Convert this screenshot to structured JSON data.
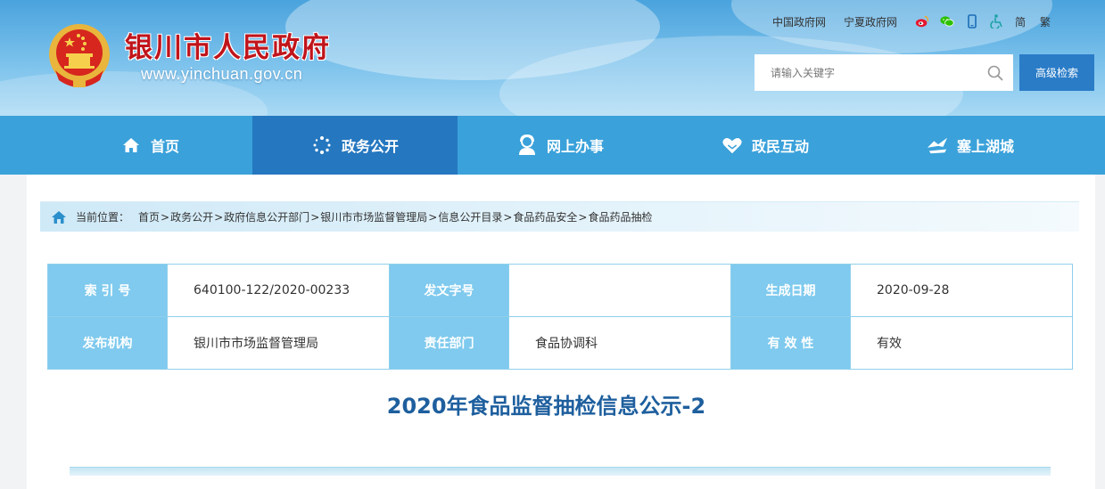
{
  "header": {
    "site_title": "银川市人民政府",
    "site_url": "www.yinchuan.gov.cn",
    "emblem_icon": "national-emblem-icon",
    "top_links": [
      "中国政府网",
      "宁夏政府网"
    ],
    "top_icons": [
      "weibo-icon",
      "wechat-icon",
      "mobile-icon",
      "accessibility-icon"
    ],
    "lang": {
      "simplified": "简",
      "traditional": "繁"
    },
    "search": {
      "placeholder": "请输入关键字",
      "icon": "search-icon"
    },
    "advanced_search": "高级检索"
  },
  "nav": {
    "items": [
      {
        "label": "首页",
        "icon": "home-icon"
      },
      {
        "label": "政务公开",
        "icon": "dots-circle-icon"
      },
      {
        "label": "网上办事",
        "icon": "service-person-icon"
      },
      {
        "label": "政民互动",
        "icon": "heart-hands-icon"
      },
      {
        "label": "塞上湖城",
        "icon": "city-bird-icon"
      }
    ],
    "active_index": 1
  },
  "breadcrumb": {
    "label": "当前位置：",
    "items": [
      "首页",
      "政务公开",
      "政府信息公开部门",
      "银川市市场监督管理局",
      "信息公开目录",
      "食品药品安全",
      "食品药品抽检"
    ],
    "separator": ">"
  },
  "meta": {
    "row1": [
      {
        "key": "索 引 号",
        "value": "640100-122/2020-00233"
      },
      {
        "key": "发文字号",
        "value": ""
      },
      {
        "key": "生成日期",
        "value": "2020-09-28"
      }
    ],
    "row2": [
      {
        "key": "发布机构",
        "value": "银川市市场监督管理局"
      },
      {
        "key": "责任部门",
        "value": "食品协调科"
      },
      {
        "key": "有 效 性",
        "value": "有效"
      }
    ]
  },
  "document": {
    "title": "2020年食品监督抽检信息公示-2"
  },
  "colors": {
    "nav_bg": "#3aa1da",
    "nav_active": "#2577bf",
    "title_red": "#c0141b",
    "key_cell": "#7fcaee",
    "doc_title": "#1e5f9e"
  }
}
